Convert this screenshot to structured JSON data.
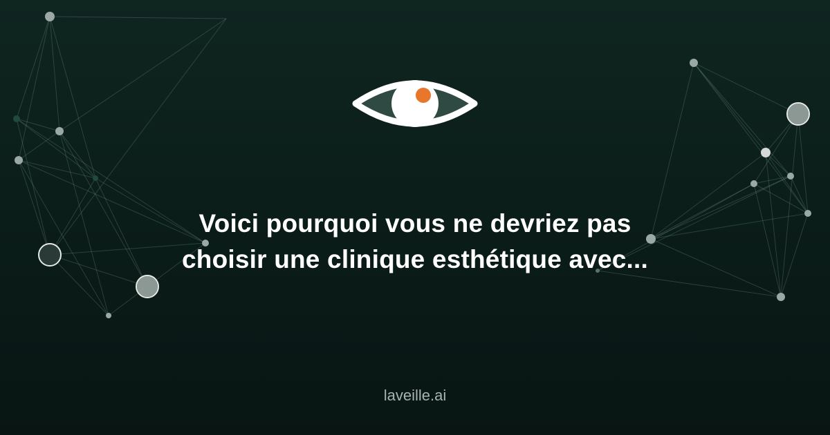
{
  "headline": "Voici pourquoi vous ne devriez pas choisir une clinique esthétique avec...",
  "brand": "laveille.ai",
  "logo": {
    "icon": "eye-icon",
    "iris_color": "#2f4a43",
    "pupil_accent": "#e8762b"
  },
  "decorations": {
    "icon": "network-graph",
    "line_color": "#7fa398"
  }
}
